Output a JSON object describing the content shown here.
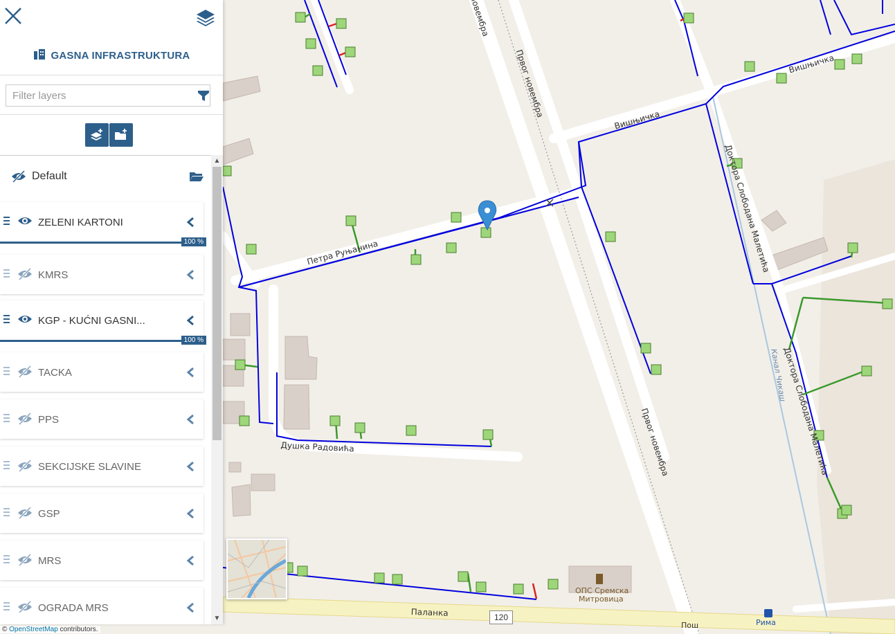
{
  "panel": {
    "title": "GASNA INFRASTRUKTURA",
    "filter_placeholder": "Filter layers",
    "group": {
      "label": "Default"
    },
    "layers": [
      {
        "name": "ZELENI KARTONI",
        "visible": true,
        "opacity": "100 %"
      },
      {
        "name": "KMRS",
        "visible": false
      },
      {
        "name": "KGP - KUĆNI GASNI...",
        "visible": true,
        "opacity": "100 %"
      },
      {
        "name": "TACKA",
        "visible": false
      },
      {
        "name": "PPS",
        "visible": false
      },
      {
        "name": "SEKCIJSKE SLAVINE",
        "visible": false
      },
      {
        "name": "GSP",
        "visible": false
      },
      {
        "name": "MRS",
        "visible": false
      },
      {
        "name": "OGRADA MRS",
        "visible": false
      }
    ]
  },
  "map": {
    "streets": {
      "petra": "Петра Руњанина",
      "prvog_top": "Првог новембра",
      "prvog_top2": "новембра",
      "prvog_bottom": "Првог новембра",
      "visnjicka1": "Вишњичка",
      "visnjicka2": "Вишњичка",
      "doktora1": "Доктора Слободана Малетића",
      "doktora2": "Доктора Слободана Малетића",
      "duska": "Душка Радовића",
      "palanka": "Паланка",
      "kanal": "Канал Чикаш",
      "ops": "ОПС Сремска",
      "ops2": "Митровица",
      "road_number": "120",
      "bottom1": "Рима",
      "bottom2": "Пош"
    },
    "attribution_symbol": "©",
    "attribution_link": "OpenStreetMap",
    "attribution_rest": " contributors.",
    "colors": {
      "pipe": "#0000dd",
      "connection": "#3a9a2a",
      "valve": "#dd2222",
      "marker": "#3a8ed4",
      "card": "#9ed67a",
      "accent": "#2d5f8b"
    }
  }
}
